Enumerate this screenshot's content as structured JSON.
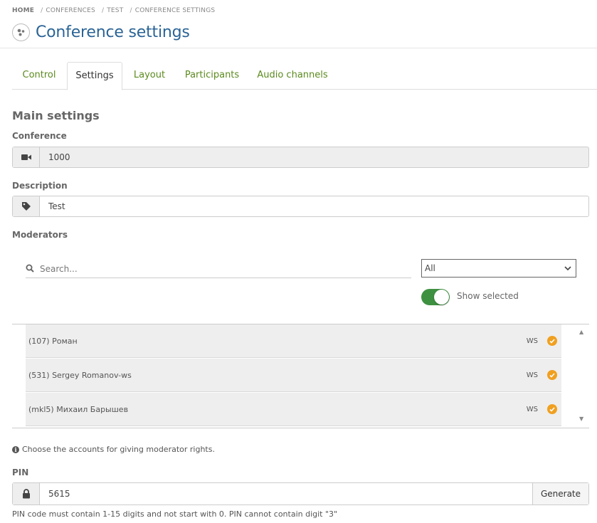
{
  "breadcrumb": {
    "home": "HOME",
    "items": [
      "CONFERENCES",
      "TEST",
      "CONFERENCE SETTINGS"
    ]
  },
  "page": {
    "title": "Conference settings",
    "icon": "conference-settings-icon"
  },
  "tabs": [
    {
      "label": "Control",
      "active": false
    },
    {
      "label": "Settings",
      "active": true
    },
    {
      "label": "Layout",
      "active": false
    },
    {
      "label": "Participants",
      "active": false
    },
    {
      "label": "Audio channels",
      "active": false
    }
  ],
  "main_settings": {
    "title": "Main settings",
    "conference": {
      "label": "Conference",
      "value": "1000",
      "icon": "video-camera-icon"
    },
    "description": {
      "label": "Description",
      "value": "Test",
      "icon": "tag-icon"
    }
  },
  "moderators": {
    "label": "Moderators",
    "search_placeholder": "Search...",
    "filter_selected": "All",
    "show_selected_label": "Show selected",
    "show_selected_on": true,
    "items": [
      {
        "name": "(107) Роман",
        "type": "WS",
        "selected": true
      },
      {
        "name": "(531) Sergey Romanov-ws",
        "type": "WS",
        "selected": true
      },
      {
        "name": "(mkl5) Михаил Барышев",
        "type": "WS",
        "selected": true
      }
    ],
    "help": "Choose the accounts for giving moderator rights."
  },
  "pin": {
    "label": "PIN",
    "value": "5615",
    "generate_label": "Generate",
    "help": "PIN code must contain 1-15 digits and not start with 0. PIN cannot contain digit \"3\""
  },
  "colors": {
    "accent_green": "#5b8a1e",
    "title_blue": "#2a6496",
    "check_orange": "#f0a020",
    "toggle_green": "#3f9142"
  }
}
